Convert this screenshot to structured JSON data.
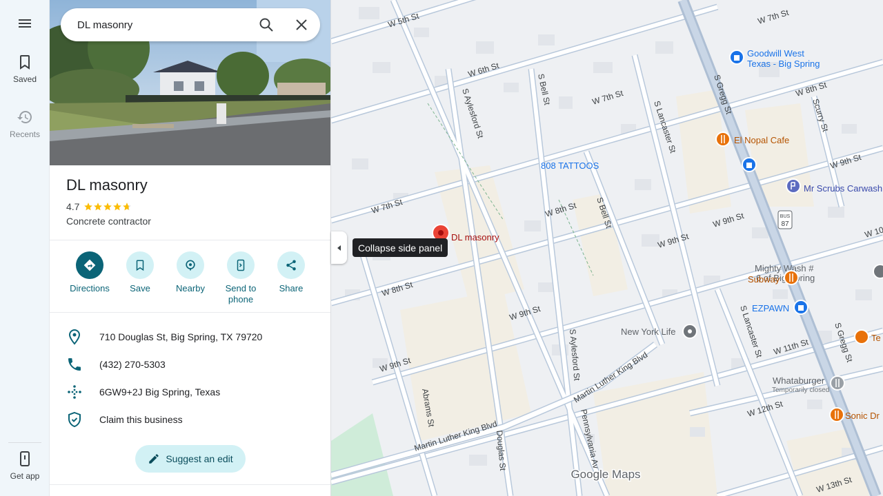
{
  "rail": {
    "menu_icon": "menu-icon",
    "saved_label": "Saved",
    "recents_label": "Recents",
    "get_app_label": "Get app"
  },
  "search": {
    "value": "DL masonry",
    "search_icon": "search-icon",
    "clear_icon": "close-icon"
  },
  "place": {
    "name": "DL masonry",
    "rating": "4.7",
    "rating_value": 4.7,
    "category": "Concrete contractor"
  },
  "actions": [
    {
      "label": "Directions",
      "icon": "directions-icon"
    },
    {
      "label": "Save",
      "icon": "bookmark-icon"
    },
    {
      "label": "Nearby",
      "icon": "nearby-icon"
    },
    {
      "label": "Send to",
      "label2": "phone",
      "icon": "send-to-phone-icon"
    },
    {
      "label": "Share",
      "icon": "share-icon"
    }
  ],
  "info": {
    "address": "710 Douglas St, Big Spring, TX 79720",
    "phone": "(432) 270-5303",
    "plus_code": "6GW9+2J Big Spring, Texas",
    "claim": "Claim this business"
  },
  "suggest_edit_label": "Suggest an edit",
  "map": {
    "collapse_tooltip": "Collapse side panel",
    "attribution": "Google Maps",
    "streets": {
      "w5": "W 5th St",
      "w6": "W 6th St",
      "w7a": "W 7th St",
      "w7b": "W 7th St",
      "w7c": "W 7th St",
      "w8a": "W 8th St",
      "w8b": "W 8th St",
      "w8c": "W 8th St",
      "w9a": "W 9th St",
      "w9b": "W 9th St",
      "w9c": "W 9th St",
      "w9d": "W 9th St",
      "w9e": "W 9th St",
      "w10": "W 10",
      "w11": "W 11th St",
      "w12": "W 12th St",
      "w13": "W 13th St",
      "aylesford1": "S Aylesford St",
      "aylesford2": "S Aylesford St",
      "bell1": "S Bell St",
      "bell2": "S Bell St",
      "lancaster1": "S Lancaster St",
      "lancaster2": "S Lancaster St",
      "gregg1": "S Gregg St",
      "gregg2": "S Gregg St",
      "scurry": "Scurry St",
      "abrams": "Abrams St",
      "douglas": "Douglas St",
      "pennsylvania": "Pennsylvania Av",
      "mlk1": "Martin Luther King Blvd",
      "mlk2": "Martin Luther King Blvd",
      "bus": "BUS",
      "bus_num": "87"
    },
    "pois": {
      "goodwill1": "Goodwill West",
      "goodwill2": "Texas - Big Spring",
      "elnopal": "El Nopal Cafe",
      "tattoos": "808 TATTOOS",
      "mrscrubs": "Mr Scrubs Carwash",
      "mightywash1": "Mighty Wash #",
      "mightywash2": "6 of Big Spring",
      "subway": "Subway",
      "ezpawn": "EZPAWN",
      "newyorklife": "New York Life",
      "whataburger": "Whataburger",
      "whataburger_status": "Temporarily closed",
      "sonic": "Sonic Dr",
      "te": "Te",
      "pin": "DL masonry"
    },
    "colors": {
      "road": "#ffffff",
      "road_casing": "#b8c8db",
      "major_road": "#aebfd4",
      "land": "#eef0f3",
      "sand": "#f2eee4",
      "park": "#cfecd9",
      "building": "#e2e5ea",
      "pin": "#ea4335",
      "shop_blue": "#1a73e8",
      "food_orange": "#e8710a",
      "service_purple": "#5c6bc0",
      "grey_poi": "#70757a"
    }
  }
}
